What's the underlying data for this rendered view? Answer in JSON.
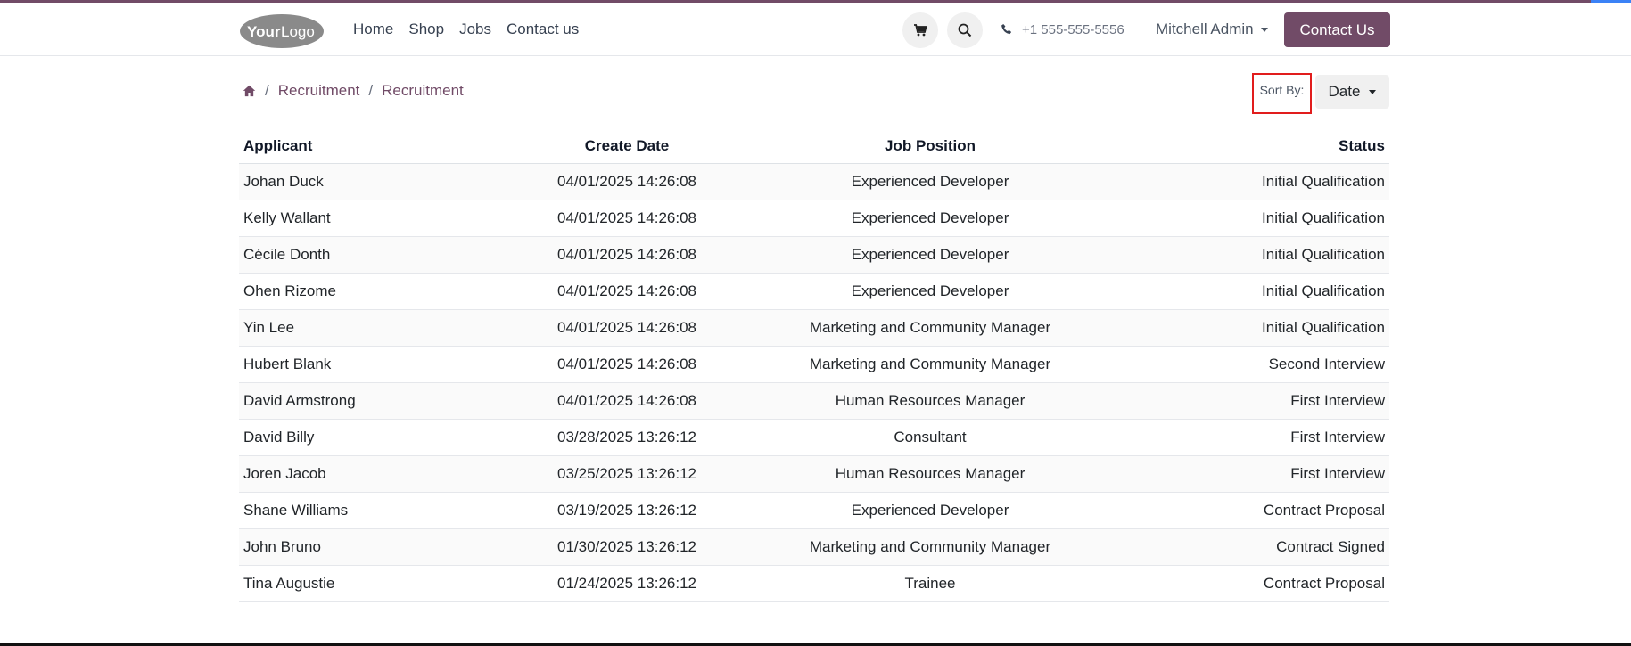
{
  "header": {
    "logo_text_1": "Your",
    "logo_text_2": "Logo",
    "nav": [
      "Home",
      "Shop",
      "Jobs",
      "Contact us"
    ],
    "phone": "+1 555-555-5556",
    "user": "Mitchell Admin",
    "contact_button": "Contact Us",
    "accent_color": "#714b67"
  },
  "breadcrumb": {
    "items": [
      "Recruitment",
      "Recruitment"
    ],
    "separator": "/"
  },
  "sort": {
    "label": "Sort By:",
    "value": "Date"
  },
  "table": {
    "headers": [
      "Applicant",
      "Create Date",
      "Job Position",
      "Status"
    ],
    "rows": [
      [
        "Johan Duck",
        "04/01/2025 14:26:08",
        "Experienced Developer",
        "Initial Qualification"
      ],
      [
        "Kelly Wallant",
        "04/01/2025 14:26:08",
        "Experienced Developer",
        "Initial Qualification"
      ],
      [
        "Cécile Donth",
        "04/01/2025 14:26:08",
        "Experienced Developer",
        "Initial Qualification"
      ],
      [
        "Ohen Rizome",
        "04/01/2025 14:26:08",
        "Experienced Developer",
        "Initial Qualification"
      ],
      [
        "Yin Lee",
        "04/01/2025 14:26:08",
        "Marketing and Community Manager",
        "Initial Qualification"
      ],
      [
        "Hubert Blank",
        "04/01/2025 14:26:08",
        "Marketing and Community Manager",
        "Second Interview"
      ],
      [
        "David Armstrong",
        "04/01/2025 14:26:08",
        "Human Resources Manager",
        "First Interview"
      ],
      [
        "David Billy",
        "03/28/2025 13:26:12",
        "Consultant",
        "First Interview"
      ],
      [
        "Joren Jacob",
        "03/25/2025 13:26:12",
        "Human Resources Manager",
        "First Interview"
      ],
      [
        "Shane Williams",
        "03/19/2025 13:26:12",
        "Experienced Developer",
        "Contract Proposal"
      ],
      [
        "John Bruno",
        "01/30/2025 13:26:12",
        "Marketing and Community Manager",
        "Contract Signed"
      ],
      [
        "Tina Augustie",
        "01/24/2025 13:26:12",
        "Trainee",
        "Contract Proposal"
      ]
    ]
  }
}
